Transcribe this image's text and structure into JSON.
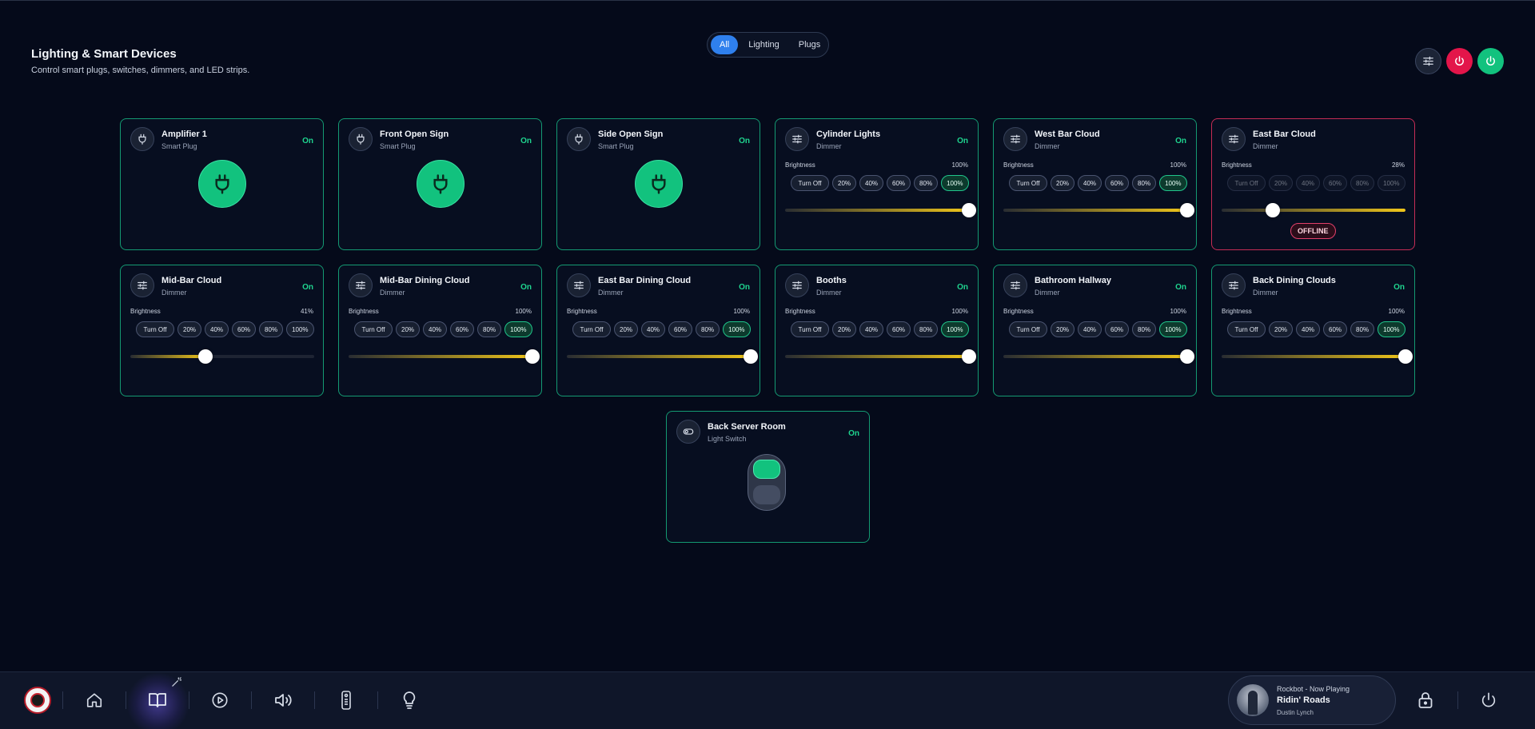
{
  "header": {
    "title": "Lighting & Smart Devices",
    "subtitle": "Control smart plugs, switches, dimmers, and LED strips."
  },
  "filters": [
    {
      "label": "All",
      "active": true
    },
    {
      "label": "Lighting",
      "active": false
    },
    {
      "label": "Plugs",
      "active": false
    }
  ],
  "header_actions": [
    {
      "icon": "sliders-icon"
    },
    {
      "icon": "power-off-icon"
    },
    {
      "icon": "power-on-icon"
    }
  ],
  "devices": {
    "amplifier_1": {
      "name": "Amplifier 1",
      "type": "Smart Plug",
      "state": "On"
    },
    "front_open_sign": {
      "name": "Front Open Sign",
      "type": "Smart Plug",
      "state": "On"
    },
    "side_open_sign": {
      "name": "Side Open Sign",
      "type": "Smart Plug",
      "state": "On"
    },
    "cylinder_lights": {
      "name": "Cylinder Lights",
      "type": "Dimmer",
      "state": "On",
      "brightness_label": "Brightness",
      "brightness": "100%",
      "level": 1.0
    },
    "west_bar_cloud": {
      "name": "West Bar Cloud",
      "type": "Dimmer",
      "state": "On",
      "brightness_label": "Brightness",
      "brightness": "100%",
      "level": 1.0
    },
    "east_bar_cloud": {
      "name": "East Bar Cloud",
      "type": "Dimmer",
      "state": "",
      "brightness_label": "Brightness",
      "brightness": "28%",
      "level": 0.28,
      "status_badge": "OFFLINE"
    },
    "mid_bar_cloud": {
      "name": "Mid-Bar Cloud",
      "type": "Dimmer",
      "state": "On",
      "brightness_label": "Brightness",
      "brightness": "41%",
      "level": 0.41
    },
    "mid_bar_dining_cloud": {
      "name": "Mid-Bar Dining Cloud",
      "type": "Dimmer",
      "state": "On",
      "brightness_label": "Brightness",
      "brightness": "100%",
      "level": 1.0
    },
    "east_bar_dining_cloud": {
      "name": "East Bar Dining Cloud",
      "type": "Dimmer",
      "state": "On",
      "brightness_label": "Brightness",
      "brightness": "100%",
      "level": 1.0
    },
    "booths": {
      "name": "Booths",
      "type": "Dimmer",
      "state": "On",
      "brightness_label": "Brightness",
      "brightness": "100%",
      "level": 1.0
    },
    "bathroom_hallway": {
      "name": "Bathroom Hallway",
      "type": "Dimmer",
      "state": "On",
      "brightness_label": "Brightness",
      "brightness": "100%",
      "level": 1.0
    },
    "back_dining_clouds": {
      "name": "Back Dining Clouds",
      "type": "Dimmer",
      "state": "On",
      "brightness_label": "Brightness",
      "brightness": "100%",
      "level": 1.0
    },
    "back_server_room": {
      "name": "Back Server Room",
      "type": "Light Switch",
      "state": "On"
    }
  },
  "presets": {
    "turn_off": "Turn Off",
    "p20": "20%",
    "p40": "40%",
    "p60": "60%",
    "p80": "80%",
    "p100": "100%"
  },
  "bottom_nav": [
    {
      "icon": "home-icon"
    },
    {
      "icon": "book-open-icon"
    },
    {
      "icon": "play-circle-icon"
    },
    {
      "icon": "volume-icon"
    },
    {
      "icon": "remote-icon"
    },
    {
      "icon": "lightbulb-icon"
    }
  ],
  "now_playing": {
    "source": "Rockbot - Now Playing",
    "title": "Ridin' Roads",
    "artist": "Dustin Lynch"
  },
  "colors": {
    "accent_green": "#12c27e",
    "accent_blue": "#2f80ed",
    "danger_red": "#e3154a",
    "slider_yellow": "#f0c61a",
    "background": "#050a1a"
  }
}
